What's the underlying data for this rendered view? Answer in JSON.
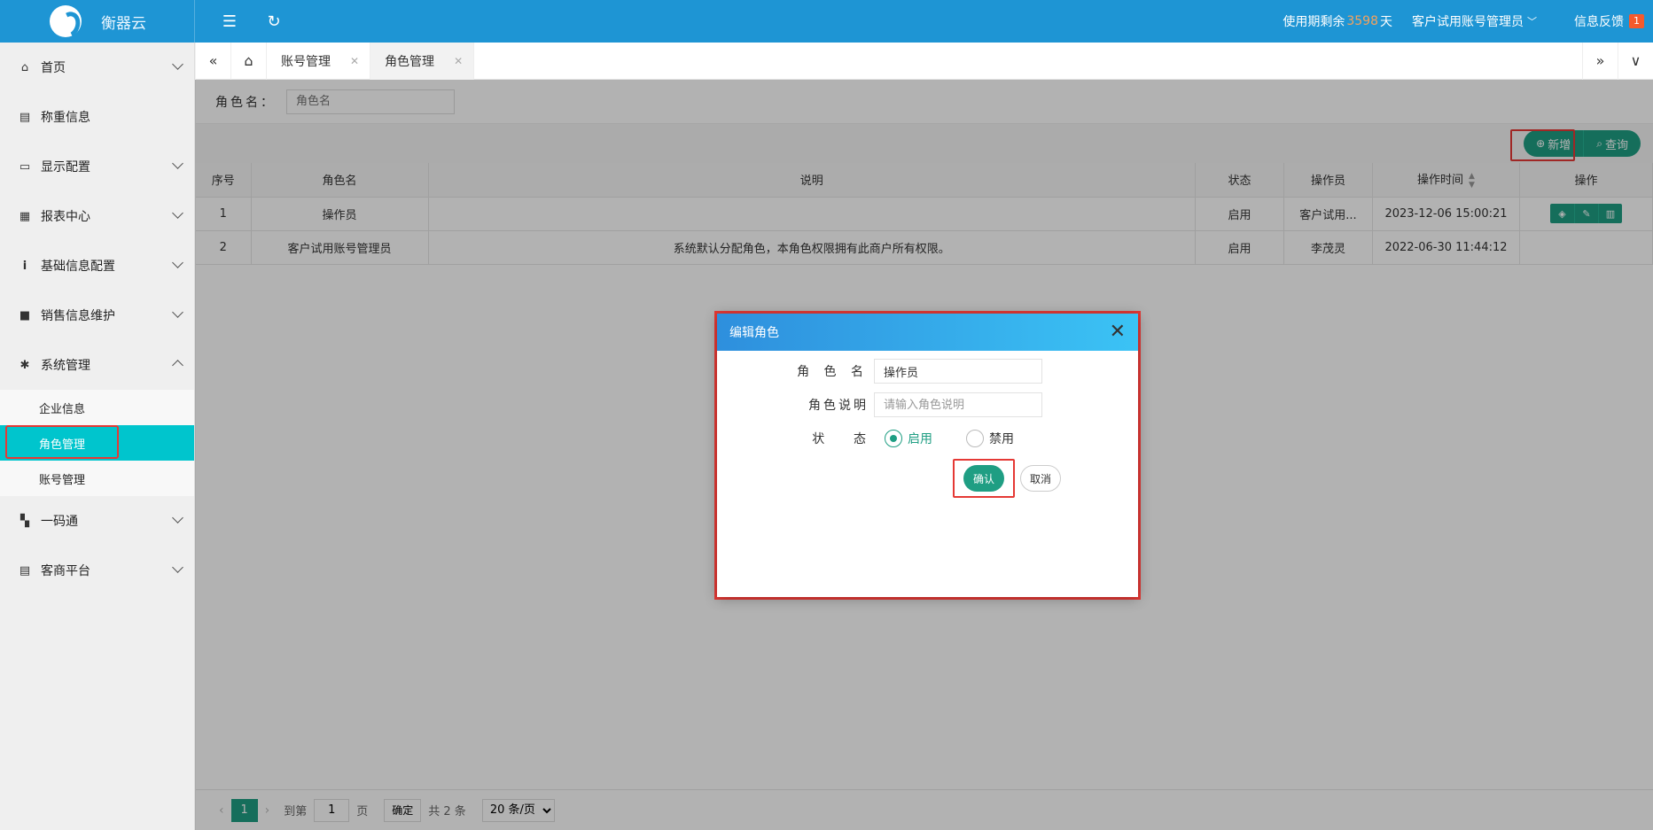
{
  "header": {
    "logo_text": "衡器云",
    "days_prefix": "使用期剩余",
    "days_value": "3598",
    "days_suffix": "天",
    "user_name": "客户试用账号管理员",
    "feedback_label": "信息反馈",
    "feedback_badge": "1"
  },
  "sidebar": {
    "items": [
      {
        "label": "首页",
        "icon": "home-icon",
        "glyph": "⌂"
      },
      {
        "label": "称重信息",
        "icon": "scale-icon",
        "glyph": "▤"
      },
      {
        "label": "显示配置",
        "icon": "monitor-icon",
        "glyph": "▭"
      },
      {
        "label": "报表中心",
        "icon": "report-icon",
        "glyph": "▦"
      },
      {
        "label": "基础信息配置",
        "icon": "info-icon",
        "glyph": "i"
      },
      {
        "label": "销售信息维护",
        "icon": "sales-icon",
        "glyph": "■"
      },
      {
        "label": "系统管理",
        "icon": "gear-icon",
        "glyph": "✱"
      },
      {
        "label": "一码通",
        "icon": "qrcode-icon",
        "glyph": "▚"
      },
      {
        "label": "客商平台",
        "icon": "platform-icon",
        "glyph": "▤"
      }
    ],
    "sub_items": [
      "企业信息",
      "角色管理",
      "账号管理"
    ]
  },
  "tabs": {
    "items": [
      "账号管理",
      "角色管理"
    ]
  },
  "search": {
    "label": "角色名：",
    "placeholder": "角色名"
  },
  "toolbar": {
    "add_label": "新增",
    "query_label": "查询"
  },
  "table": {
    "headers": [
      "序号",
      "角色名",
      "说明",
      "状态",
      "操作员",
      "操作时间",
      "操作"
    ],
    "rows": [
      {
        "no": "1",
        "name": "操作员",
        "desc": "",
        "status": "启用",
        "operator": "客户试用...",
        "time": "2023-12-06 15:00:21"
      },
      {
        "no": "2",
        "name": "客户试用账号管理员",
        "desc": "系统默认分配角色，本角色权限拥有此商户所有权限。",
        "status": "启用",
        "operator": "李茂灵",
        "time": "2022-06-30 11:44:12"
      }
    ]
  },
  "pager": {
    "current": "1",
    "goto_label": "到第",
    "goto_value": "1",
    "page_unit": "页",
    "confirm_label": "确定",
    "total": "共 2 条",
    "page_size": "20 条/页"
  },
  "modal": {
    "title": "编辑角色",
    "name_label": "角 色 名",
    "name_value": "操作员",
    "desc_label": "角色说明",
    "desc_placeholder": "请输入角色说明",
    "status_label": "状    态",
    "status_on": "启用",
    "status_off": "禁用",
    "ok_label": "确认",
    "cancel_label": "取消"
  },
  "colors": {
    "header_blue": "#1e95d4",
    "accent_green": "#1f9e83",
    "active_cyan": "#00c5cd",
    "highlight_red": "#e53935"
  }
}
